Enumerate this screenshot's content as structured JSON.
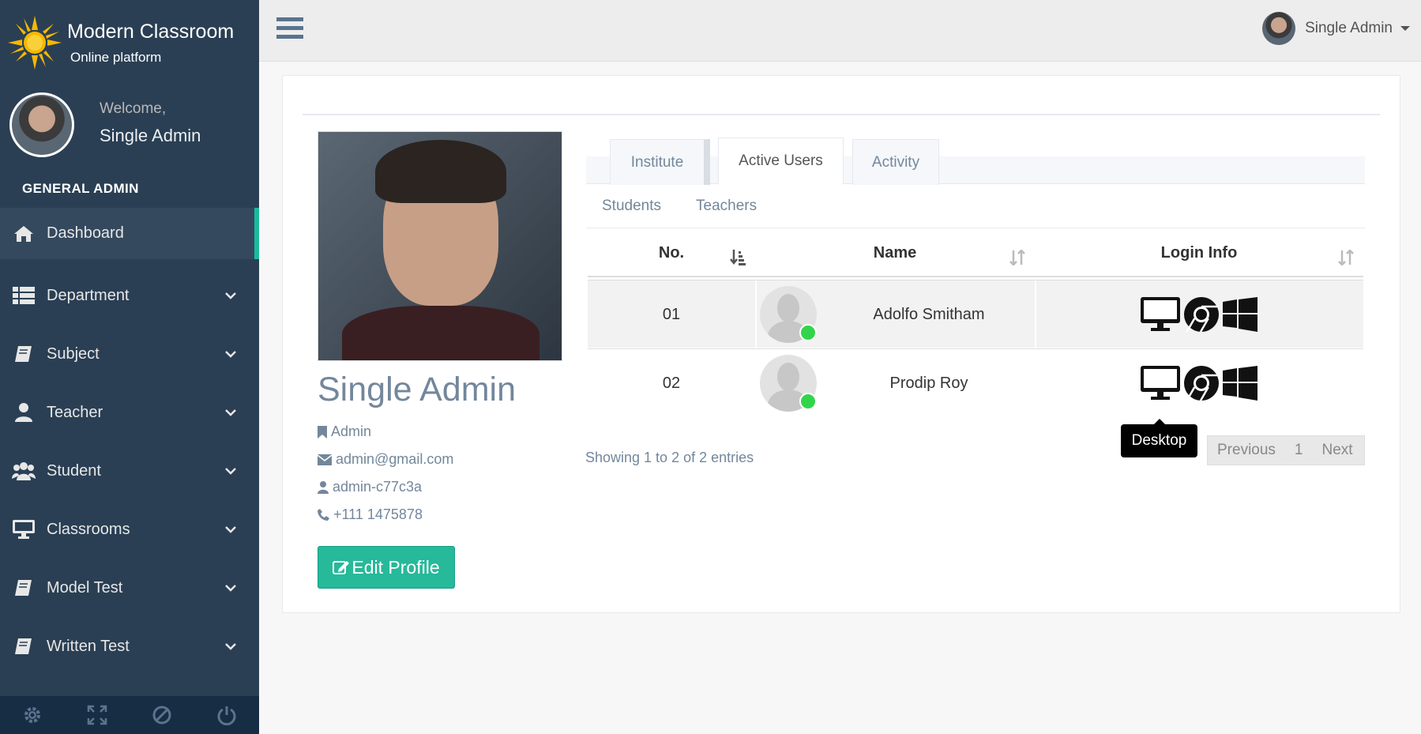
{
  "brand": {
    "title": "Modern Classroom",
    "subtitle": "Online platform"
  },
  "sidebar": {
    "welcome": "Welcome,",
    "user_name": "Single Admin",
    "section_title": "GENERAL ADMIN",
    "items": [
      {
        "label": "Dashboard",
        "icon": "home-icon",
        "active": true
      },
      {
        "label": "Department",
        "icon": "list-icon"
      },
      {
        "label": "Subject",
        "icon": "book-icon"
      },
      {
        "label": "Teacher",
        "icon": "user-icon"
      },
      {
        "label": "Student",
        "icon": "users-icon"
      },
      {
        "label": "Classrooms",
        "icon": "desktop-icon"
      },
      {
        "label": "Model Test",
        "icon": "book-icon"
      },
      {
        "label": "Written Test",
        "icon": "book-icon"
      }
    ],
    "footer_icons": [
      "settings-icon",
      "fullscreen-icon",
      "lock-icon",
      "logout-icon"
    ]
  },
  "topnav": {
    "user_name": "Single Admin"
  },
  "profile": {
    "name": "Single Admin",
    "role": "Admin",
    "email": "admin@gmail.com",
    "username": "admin-c77c3a",
    "phone": "+111 1475878",
    "edit_label": "Edit Profile"
  },
  "tabs": [
    {
      "label": "Institute"
    },
    {
      "label": "Active Users",
      "active": true
    },
    {
      "label": "Activity"
    }
  ],
  "subtabs": [
    {
      "label": "Students"
    },
    {
      "label": "Teachers"
    }
  ],
  "table": {
    "headers": [
      "No.",
      "Name",
      "Login Info"
    ],
    "rows": [
      {
        "no": "01",
        "name": "Adolfo Smitham",
        "device": "desktop-icon",
        "browser": "chrome-icon",
        "os": "windows-icon"
      },
      {
        "no": "02",
        "name": "Prodip Roy",
        "device": "desktop-icon",
        "browser": "chrome-icon",
        "os": "windows-icon"
      }
    ],
    "tooltip": "Desktop",
    "info": "Showing 1 to 2 of 2 entries",
    "pager": {
      "previous": "Previous",
      "page": "1",
      "next": "Next"
    }
  },
  "colors": {
    "sidebar": "#2A3F54",
    "accent": "#1ABB9C",
    "button": "#26B99A",
    "online": "#31D54C"
  }
}
